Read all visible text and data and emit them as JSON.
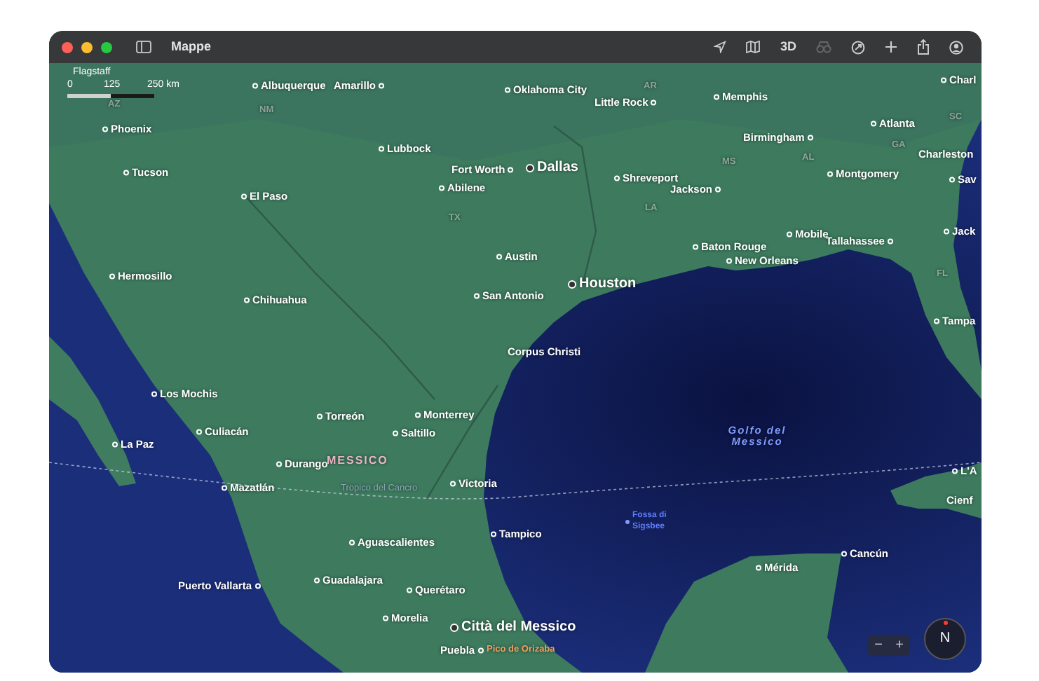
{
  "window": {
    "title": "Mappe"
  },
  "toolbar": {
    "view_3d": "3D",
    "look_around": {
      "disabled": true
    }
  },
  "scale": {
    "place": "Flagstaff",
    "ticks": [
      "0",
      "125",
      "250 km"
    ]
  },
  "labels": [
    {
      "text": "AZ",
      "kind": "state"
    },
    {
      "text": "Albuquerque",
      "kind": "city"
    },
    {
      "text": "Amarillo",
      "kind": "city"
    },
    {
      "text": "Oklahoma City",
      "kind": "city"
    },
    {
      "text": "Little Rock",
      "kind": "city"
    },
    {
      "text": "Memphis",
      "kind": "city"
    },
    {
      "text": "Charl",
      "kind": "city"
    },
    {
      "text": "NM",
      "kind": "state"
    },
    {
      "text": "AR",
      "kind": "state"
    },
    {
      "text": "SC",
      "kind": "state"
    },
    {
      "text": "Phoenix",
      "kind": "city"
    },
    {
      "text": "Atlanta",
      "kind": "city"
    },
    {
      "text": "Birmingham",
      "kind": "city"
    },
    {
      "text": "Lubbock",
      "kind": "city"
    },
    {
      "text": "GA",
      "kind": "state"
    },
    {
      "text": "Charleston",
      "kind": "city"
    },
    {
      "text": "AL",
      "kind": "state"
    },
    {
      "text": "MS",
      "kind": "state"
    },
    {
      "text": "Fort Worth",
      "kind": "city"
    },
    {
      "text": "Dallas",
      "kind": "major"
    },
    {
      "text": "Tucson",
      "kind": "city"
    },
    {
      "text": "Shreveport",
      "kind": "city"
    },
    {
      "text": "Montgomery",
      "kind": "city"
    },
    {
      "text": "Sav",
      "kind": "city"
    },
    {
      "text": "Abilene",
      "kind": "city"
    },
    {
      "text": "Jackson",
      "kind": "city"
    },
    {
      "text": "El Paso",
      "kind": "city"
    },
    {
      "text": "LA",
      "kind": "state"
    },
    {
      "text": "TX",
      "kind": "state"
    },
    {
      "text": "Jack",
      "kind": "city"
    },
    {
      "text": "Mobile",
      "kind": "city"
    },
    {
      "text": "Tallahassee",
      "kind": "city"
    },
    {
      "text": "Baton Rouge",
      "kind": "city"
    },
    {
      "text": "Austin",
      "kind": "city"
    },
    {
      "text": "New Orleans",
      "kind": "city"
    },
    {
      "text": "FL",
      "kind": "state"
    },
    {
      "text": "Hermosillo",
      "kind": "city"
    },
    {
      "text": "Houston",
      "kind": "major"
    },
    {
      "text": "San Antonio",
      "kind": "city"
    },
    {
      "text": "Chihuahua",
      "kind": "city"
    },
    {
      "text": "Tampa",
      "kind": "city"
    },
    {
      "text": "Corpus Christi",
      "kind": "city"
    },
    {
      "text": "Los Mochis",
      "kind": "city"
    },
    {
      "text": "Torreón",
      "kind": "city"
    },
    {
      "text": "Monterrey",
      "kind": "city"
    },
    {
      "text": "Culiacán",
      "kind": "city"
    },
    {
      "text": "Saltillo",
      "kind": "city"
    },
    {
      "text": "La Paz",
      "kind": "city"
    },
    {
      "text": "Golfo del Messico",
      "kind": "water"
    },
    {
      "text": "Durango",
      "kind": "city"
    },
    {
      "text": "MESSICO",
      "kind": "country"
    },
    {
      "text": "L'A",
      "kind": "city"
    },
    {
      "text": "Mazatlán",
      "kind": "city"
    },
    {
      "text": "Tropico del Cancro",
      "kind": "line"
    },
    {
      "text": "Victoria",
      "kind": "city"
    },
    {
      "text": "Cienf",
      "kind": "city"
    },
    {
      "text": "Fossa di Sigsbee",
      "kind": "water"
    },
    {
      "text": "Tampico",
      "kind": "city"
    },
    {
      "text": "Aguascalientes",
      "kind": "city"
    },
    {
      "text": "Cancún",
      "kind": "city"
    },
    {
      "text": "Mérida",
      "kind": "city"
    },
    {
      "text": "Guadalajara",
      "kind": "city"
    },
    {
      "text": "Puerto Vallarta",
      "kind": "city"
    },
    {
      "text": "Querétaro",
      "kind": "city"
    },
    {
      "text": "Morelia",
      "kind": "city"
    },
    {
      "text": "Città del Messico",
      "kind": "major"
    },
    {
      "text": "Puebla",
      "kind": "city"
    },
    {
      "text": "Pico de Orizaba",
      "kind": "peak"
    }
  ],
  "zoom_control": {
    "minus": "−",
    "plus": "+"
  },
  "compass": {
    "label": "N"
  }
}
